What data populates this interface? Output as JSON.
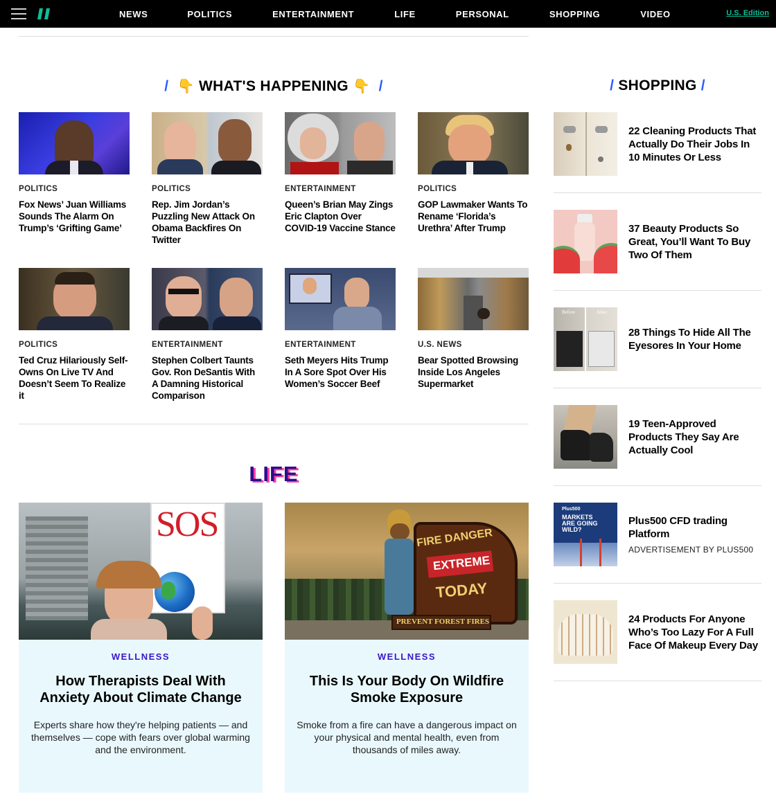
{
  "nav": {
    "links": [
      "NEWS",
      "POLITICS",
      "ENTERTAINMENT",
      "LIFE",
      "PERSONAL",
      "SHOPPING",
      "VIDEO"
    ],
    "edition": "U.S. Edition",
    "accent": "#0dbe98"
  },
  "whats_happening": {
    "title": "WHAT'S HAPPENING",
    "emoji": "👇",
    "slash": "/",
    "articles": [
      {
        "category": "POLITICS",
        "headline": "Fox News’ Juan Williams Sounds The Alarm On Trump’s ‘Grifting Game’"
      },
      {
        "category": "POLITICS",
        "headline": "Rep. Jim Jordan’s Puzzling New Attack On Obama Backfires On Twitter"
      },
      {
        "category": "ENTERTAINMENT",
        "headline": "Queen’s Brian May Zings Eric Clapton Over COVID-19 Vaccine Stance"
      },
      {
        "category": "POLITICS",
        "headline": "GOP Lawmaker Wants To Rename ‘Florida’s Urethra’ After Trump"
      },
      {
        "category": "POLITICS",
        "headline": "Ted Cruz Hilariously Self-Owns On Live TV And Doesn’t Seem To Realize it"
      },
      {
        "category": "ENTERTAINMENT",
        "headline": "Stephen Colbert Taunts Gov. Ron DeSantis With A Damning Historical Comparison"
      },
      {
        "category": "ENTERTAINMENT",
        "headline": "Seth Meyers Hits Trump In A Sore Spot Over His Women’s Soccer Beef"
      },
      {
        "category": "U.S. NEWS",
        "headline": "Bear Spotted Browsing Inside Los Angeles Supermarket"
      }
    ]
  },
  "shopping": {
    "title": "SHOPPING",
    "items": [
      {
        "title": "22 Cleaning Products That Actually Do Their Jobs In 10 Minutes Or Less",
        "sub": ""
      },
      {
        "title": "37 Beauty Products So Great, You’ll Want To Buy Two Of Them",
        "sub": ""
      },
      {
        "title": "28 Things To Hide All The Eyesores In Your Home",
        "sub": "",
        "thumb_labels": [
          "Before",
          "After"
        ]
      },
      {
        "title": "19 Teen-Approved Products They Say Are Actually Cool",
        "sub": ""
      },
      {
        "title": "Plus500 CFD trading Platform",
        "sub": "ADVERTISEMENT BY PLUS500",
        "thumb_labels": [
          "Plus500",
          "MARKETS ARE GOING WILD?"
        ]
      },
      {
        "title": "24 Products For Anyone Who’s Too Lazy For A Full Face Of Makeup Every Day",
        "sub": ""
      }
    ]
  },
  "life": {
    "title": "LIFE",
    "cards": [
      {
        "category": "WELLNESS",
        "title": "How Therapists Deal With Anxiety About Climate Change",
        "desc": "Experts share how they're helping patients — and themselves — cope with fears over global warming and the environment.",
        "sign_text": "SOS"
      },
      {
        "category": "WELLNESS",
        "title": "This Is Your Body On Wildfire Smoke Exposure",
        "desc": "Smoke from a fire can have a dangerous impact on your physical and mental health, even from thousands of miles away.",
        "sign_lines": [
          "FIRE DANGER",
          "EXTREME",
          "TODAY",
          "PREVENT FOREST FIRES"
        ]
      }
    ]
  }
}
